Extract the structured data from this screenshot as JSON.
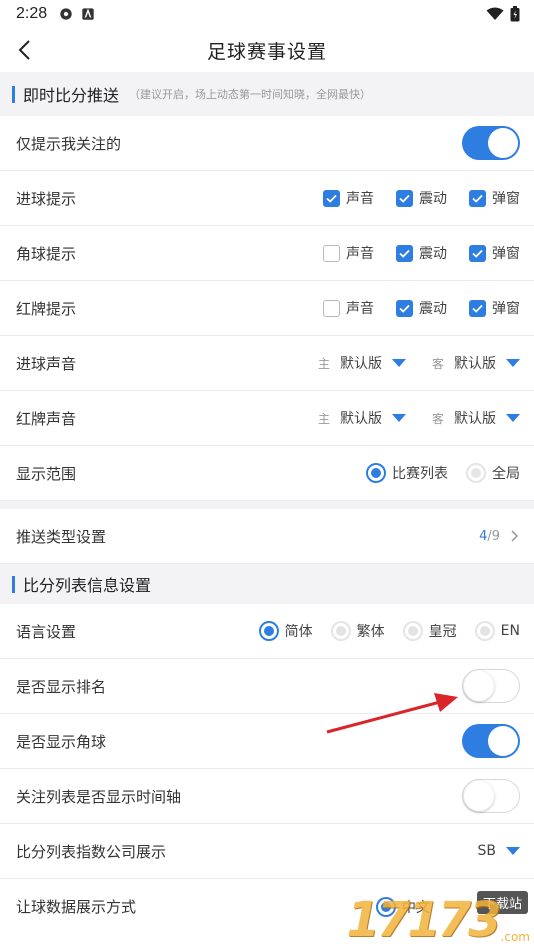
{
  "status_bar": {
    "time": "2:28"
  },
  "nav": {
    "title": "足球赛事设置"
  },
  "section1": {
    "title": "即时比分推送",
    "hint": "（建议开启，场上动态第一时间知晓，全网最快）"
  },
  "only_followed": {
    "label": "仅提示我关注的",
    "on": true
  },
  "alerts": [
    {
      "label": "进球提示",
      "options": [
        {
          "text": "声音",
          "checked": true
        },
        {
          "text": "震动",
          "checked": true
        },
        {
          "text": "弹窗",
          "checked": true
        }
      ]
    },
    {
      "label": "角球提示",
      "options": [
        {
          "text": "声音",
          "checked": false
        },
        {
          "text": "震动",
          "checked": true
        },
        {
          "text": "弹窗",
          "checked": true
        }
      ]
    },
    {
      "label": "红牌提示",
      "options": [
        {
          "text": "声音",
          "checked": false
        },
        {
          "text": "震动",
          "checked": true
        },
        {
          "text": "弹窗",
          "checked": true
        }
      ]
    }
  ],
  "sounds": [
    {
      "label": "进球声音",
      "home_prefix": "主",
      "home_value": "默认版",
      "away_prefix": "客",
      "away_value": "默认版"
    },
    {
      "label": "红牌声音",
      "home_prefix": "主",
      "home_value": "默认版",
      "away_prefix": "客",
      "away_value": "默认版"
    }
  ],
  "display_range": {
    "label": "显示范围",
    "options": [
      {
        "text": "比赛列表",
        "selected": true
      },
      {
        "text": "全局",
        "selected": false
      }
    ]
  },
  "push_type": {
    "label": "推送类型设置",
    "current": "4",
    "total": "/9"
  },
  "section2": {
    "title": "比分列表信息设置"
  },
  "language": {
    "label": "语言设置",
    "options": [
      {
        "text": "简体",
        "selected": true
      },
      {
        "text": "繁体",
        "selected": false
      },
      {
        "text": "皇冠",
        "selected": false
      },
      {
        "text": "EN",
        "selected": false
      }
    ]
  },
  "show_rank": {
    "label": "是否显示排名",
    "on": false
  },
  "show_corner": {
    "label": "是否显示角球",
    "on": true
  },
  "show_timeline": {
    "label": "关注列表是否显示时间轴",
    "on": false
  },
  "odds_company": {
    "label": "比分列表指数公司展示",
    "value": "SB"
  },
  "handicap_mode": {
    "label": "让球数据展示方式",
    "value": "中文"
  },
  "watermark": {
    "number": "17173",
    "suffix": ".com",
    "badge": "下载站"
  },
  "colors": {
    "accent": "#2e7de0",
    "arrow": "#d9262a",
    "section_bg": "#f3f3f5"
  }
}
